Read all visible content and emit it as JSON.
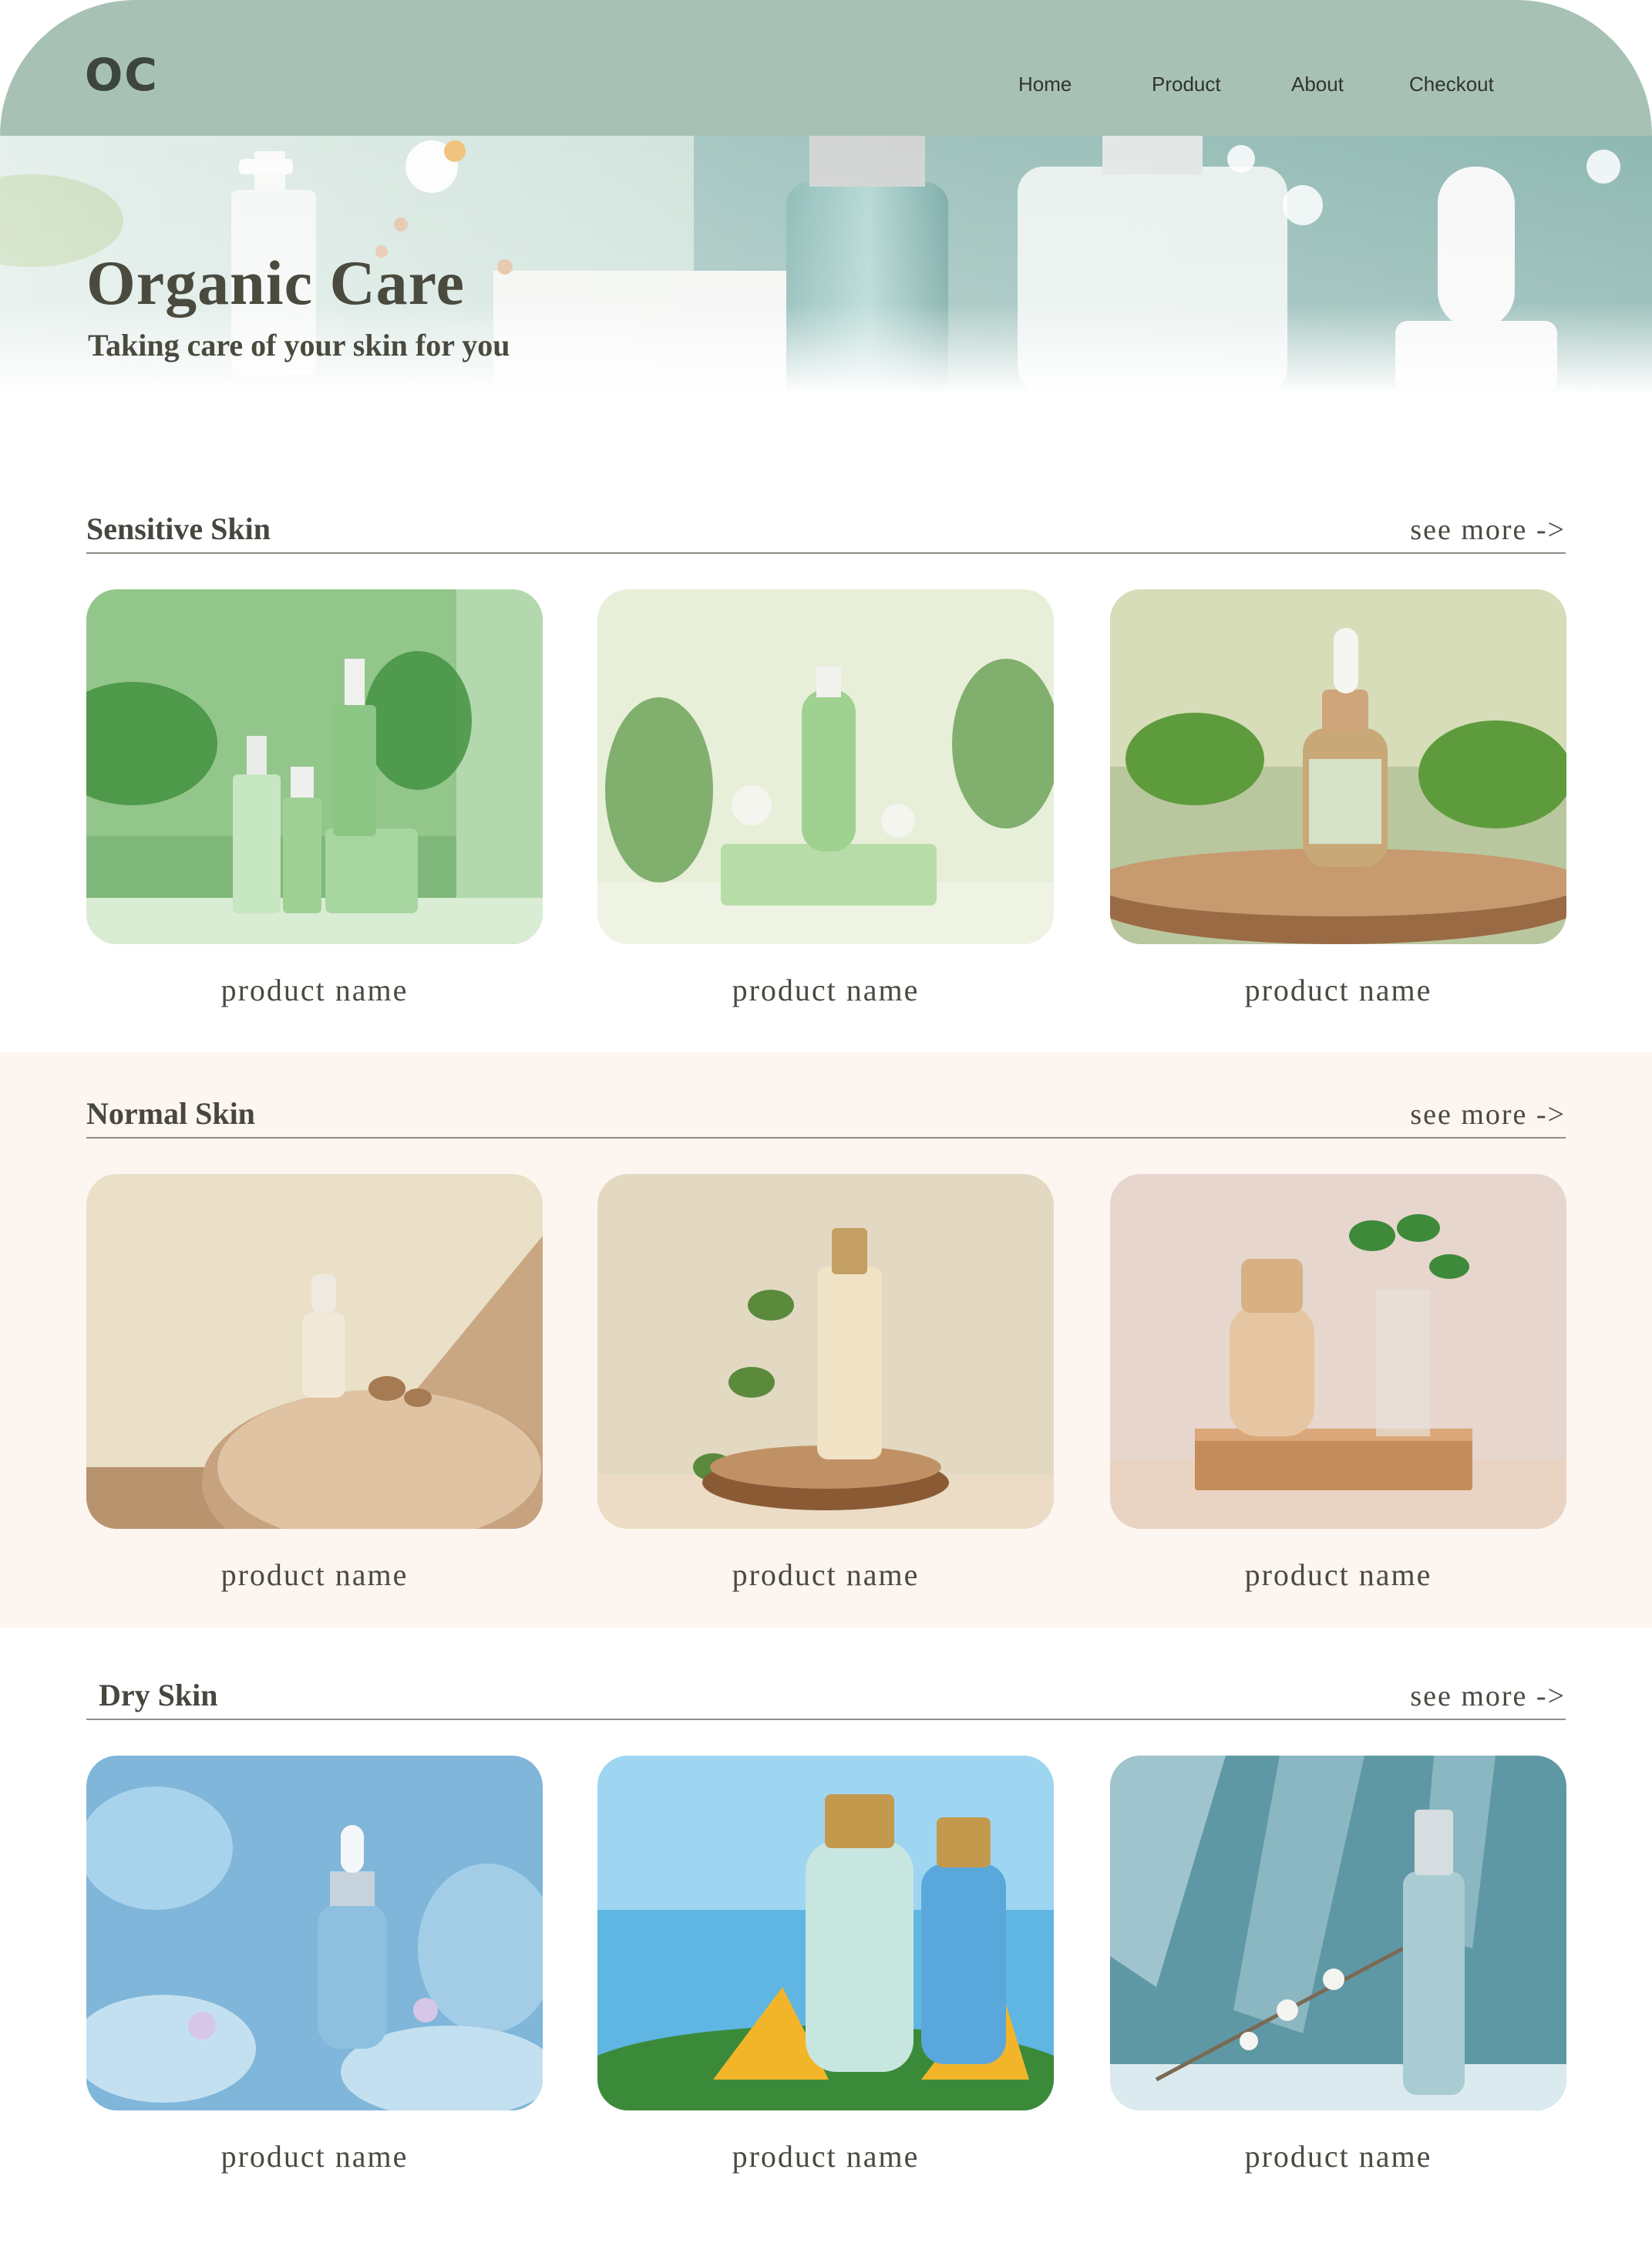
{
  "header": {
    "logo": "OC",
    "nav": [
      "Home",
      "Product",
      "About",
      "Checkout"
    ]
  },
  "hero": {
    "title": "Organic Care",
    "subtitle": "Taking care of your skin for you"
  },
  "sections": [
    {
      "title": "Sensitive Skin",
      "see_more": "see more ->",
      "products": [
        {
          "name": "product name"
        },
        {
          "name": "product name"
        },
        {
          "name": "product name"
        }
      ]
    },
    {
      "title": "Normal Skin",
      "see_more": "see more ->",
      "products": [
        {
          "name": "product name"
        },
        {
          "name": "product name"
        },
        {
          "name": "product name"
        }
      ]
    },
    {
      "title": "Dry Skin",
      "see_more": "see more ->",
      "products": [
        {
          "name": "product name"
        },
        {
          "name": "product name"
        },
        {
          "name": "product name"
        }
      ]
    }
  ],
  "colors": {
    "header_bg": "#a7c1b5",
    "normal_band_bg": "#fdf5ef",
    "text": "#4a4a42"
  }
}
